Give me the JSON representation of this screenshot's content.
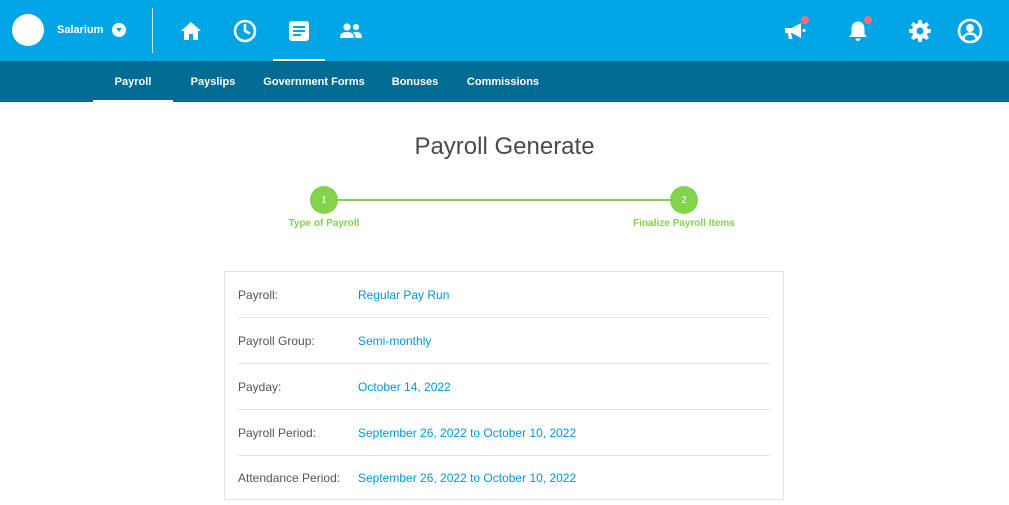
{
  "brand": {
    "name": "Salarium"
  },
  "subnav": {
    "tabs": [
      {
        "label": "Payroll"
      },
      {
        "label": "Payslips"
      },
      {
        "label": "Government Forms"
      },
      {
        "label": "Bonuses"
      },
      {
        "label": "Commissions"
      }
    ]
  },
  "page": {
    "title": "Payroll Generate"
  },
  "stepper": {
    "steps": [
      {
        "number": "1",
        "label": "Type of Payroll"
      },
      {
        "number": "2",
        "label": "Finalize Payroll Items"
      }
    ]
  },
  "details": {
    "rows": [
      {
        "label": "Payroll:",
        "value": "Regular Pay Run"
      },
      {
        "label": "Payroll Group:",
        "value": "Semi-monthly"
      },
      {
        "label": "Payday:",
        "value": "October 14, 2022"
      },
      {
        "label": "Payroll Period:",
        "value": "September 26, 2022 to October 10, 2022"
      },
      {
        "label": "Attendance Period:",
        "value": "September 26, 2022 to October 10, 2022"
      }
    ]
  },
  "colors": {
    "topbar": "#00a5e5",
    "subnav": "#006b93",
    "step": "#83d24b",
    "value": "#0098d6",
    "notification_dot": "#f2707c"
  },
  "icons": {
    "nav": [
      "home-icon",
      "clock-icon",
      "document-icon",
      "people-icon"
    ],
    "right": [
      "megaphone-icon",
      "bell-icon",
      "gear-icon",
      "user-icon"
    ]
  }
}
